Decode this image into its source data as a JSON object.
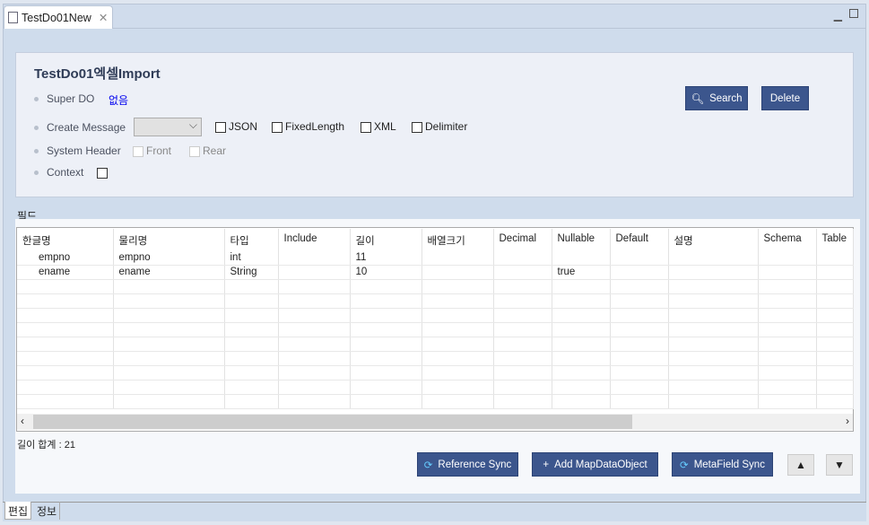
{
  "tab": {
    "title": "TestDo01New",
    "icon": "tree-icon",
    "close_icon": "close-icon"
  },
  "form": {
    "title": "TestDo01엑셀Import",
    "super_do": {
      "label": "Super DO",
      "value": "없음"
    },
    "create_message": {
      "label": "Create Message",
      "select_value": "",
      "options": [
        "JSON",
        "FixedLength",
        "XML",
        "Delimiter"
      ]
    },
    "system_header": {
      "label": "System Header",
      "options": [
        "Front",
        "Rear"
      ]
    },
    "context": {
      "label": "Context"
    },
    "search_label": "Search",
    "delete_label": "Delete"
  },
  "fields": {
    "section_label": "필드",
    "columns": [
      "한글명",
      "물리명",
      "타입",
      "Include",
      "길이",
      "배열크기",
      "Decimal",
      "Nullable",
      "Default",
      "설명",
      "Schema",
      "Table"
    ],
    "rows": [
      [
        "empno",
        "empno",
        "int",
        "",
        "11",
        "",
        "",
        "",
        "",
        "",
        "",
        ""
      ],
      [
        "ename",
        "ename",
        "String",
        "",
        "10",
        "",
        "",
        "true",
        "",
        "",
        "",
        ""
      ]
    ],
    "total_length": "길이 합계 : 21"
  },
  "actions": {
    "reference_sync": "Reference Sync",
    "add_map": "Add MapDataObject",
    "metafield_sync": "MetaField Sync",
    "up": "▲",
    "down": "▼"
  },
  "bottom_tabs": [
    "편집",
    "정보"
  ],
  "colors": {
    "button": "#3c568d",
    "link": "#0000ee"
  }
}
